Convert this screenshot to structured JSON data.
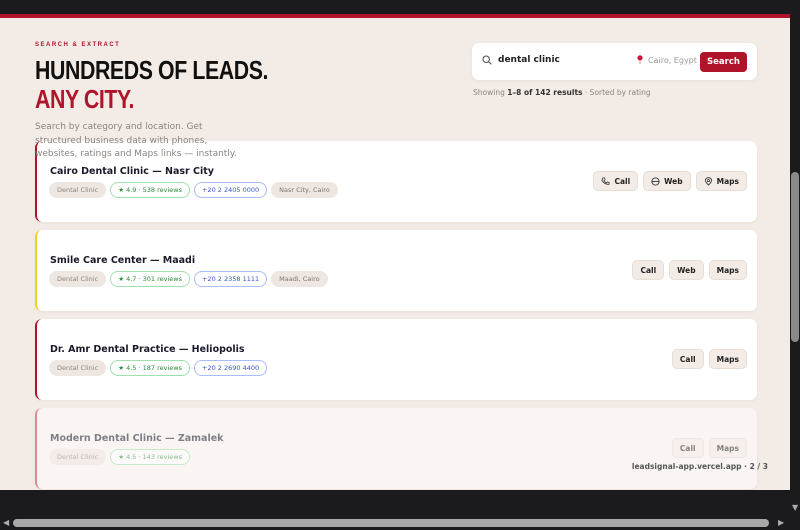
{
  "hero": {
    "eyebrow": "SEARCH & EXTRACT",
    "title_line1": "HUNDREDS OF LEADS.",
    "title_line2": "ANY CITY.",
    "description": "Search by category and location. Get structured business data with phones, websites, ratings and Maps links — instantly."
  },
  "search": {
    "query": "dental clinic",
    "location": "Cairo, Egypt",
    "button": "Search"
  },
  "results": {
    "prefix": "Showing ",
    "range": "1–8 of 142 results",
    "suffix": " · Sorted by rating"
  },
  "colors": {
    "accent": "#b0142a"
  },
  "cards": [
    {
      "name": "Cairo Dental Clinic — Nasr City",
      "category": "Dental Clinic",
      "rating": "★ 4.9 · 538 reviews",
      "phone": "+20 2 2405 0000",
      "area": "Nasr City, Cairo",
      "actions": [
        "Call",
        "Web",
        "Maps"
      ]
    },
    {
      "name": "Smile Care Center — Maadi",
      "category": "Dental Clinic",
      "rating": "★ 4.7 · 301 reviews",
      "phone": "+20 2 2358 1111",
      "area": "Maadi, Cairo",
      "actions": [
        "Call",
        "Web",
        "Maps"
      ]
    },
    {
      "name": "Dr. Amr Dental Practice — Heliopolis",
      "category": "Dental Clinic",
      "rating": "★ 4.5 · 187 reviews",
      "phone": "+20 2 2690 4400",
      "actions": [
        "Call",
        "Maps"
      ]
    },
    {
      "name": "Modern Dental Clinic — Zamalek",
      "category": "Dental Clinic",
      "rating": "★ 4.5 · 143 reviews",
      "actions": [
        "Call",
        "Maps"
      ]
    }
  ],
  "footer": "leadsignal-app.vercel.app · 2 / 3"
}
